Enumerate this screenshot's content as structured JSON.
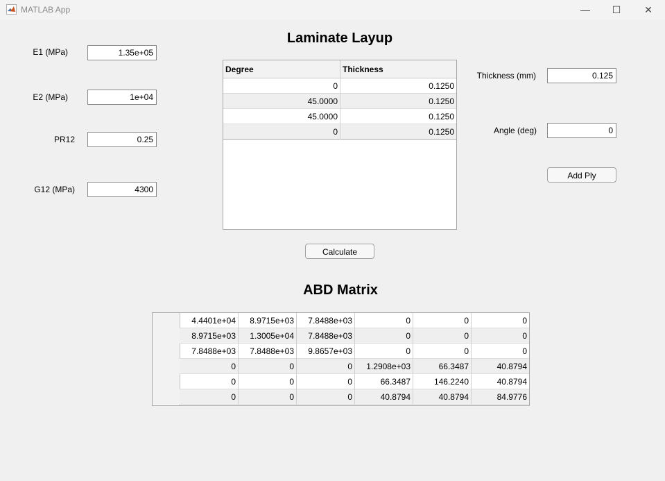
{
  "window": {
    "title": "MATLAB App",
    "minimize_glyph": "—",
    "maximize_glyph": "☐",
    "close_glyph": "✕"
  },
  "props": {
    "e1_label": "E1 (MPa)",
    "e1_value": "1.35e+05",
    "e2_label": "E2 (MPa)",
    "e2_value": "1e+04",
    "pr12_label": "PR12",
    "pr12_value": "0.25",
    "g12_label": "G12 (MPa)",
    "g12_value": "4300"
  },
  "layup": {
    "title": "Laminate Layup",
    "columns": [
      "Degree",
      "Thickness"
    ],
    "rows": [
      [
        "0",
        "0.1250"
      ],
      [
        "45.0000",
        "0.1250"
      ],
      [
        "45.0000",
        "0.1250"
      ],
      [
        "0",
        "0.1250"
      ]
    ]
  },
  "ply": {
    "thickness_label": "Thickness (mm)",
    "thickness_value": "0.125",
    "angle_label": "Angle (deg)",
    "angle_value": "0",
    "add_label": "Add Ply"
  },
  "calculate_label": "Calculate",
  "abd": {
    "title": "ABD Matrix",
    "rows": [
      [
        "4.4401e+04",
        "8.9715e+03",
        "7.8488e+03",
        "0",
        "0",
        "0"
      ],
      [
        "8.9715e+03",
        "1.3005e+04",
        "7.8488e+03",
        "0",
        "0",
        "0"
      ],
      [
        "7.8488e+03",
        "7.8488e+03",
        "9.8657e+03",
        "0",
        "0",
        "0"
      ],
      [
        "0",
        "0",
        "0",
        "1.2908e+03",
        "66.3487",
        "40.8794"
      ],
      [
        "0",
        "0",
        "0",
        "66.3487",
        "146.2240",
        "40.8794"
      ],
      [
        "0",
        "0",
        "0",
        "40.8794",
        "40.8794",
        "84.9776"
      ]
    ]
  }
}
